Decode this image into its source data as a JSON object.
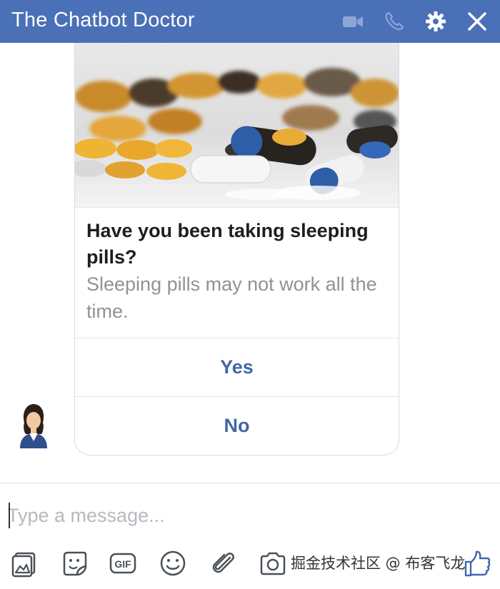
{
  "header": {
    "title": "The Chatbot Doctor",
    "icons": [
      "video-call-icon",
      "phone-icon",
      "gear-icon",
      "close-icon"
    ],
    "background_color": "#4a70b8"
  },
  "card": {
    "title": "Have you been taking sleeping pills?",
    "subtitle": "Sleeping pills may not work all the time.",
    "buttons": [
      {
        "label": "Yes"
      },
      {
        "label": "No"
      }
    ],
    "button_color": "#4467a5"
  },
  "composer": {
    "placeholder": "Type a message...",
    "tools": [
      "photo-icon",
      "sticker-icon",
      "gif-icon",
      "emoji-icon",
      "attachment-icon",
      "camera-icon",
      "thumbs-up-icon"
    ],
    "gif_label": "GIF"
  },
  "watermark": "掘金技术社区 @ 布客飞龙"
}
